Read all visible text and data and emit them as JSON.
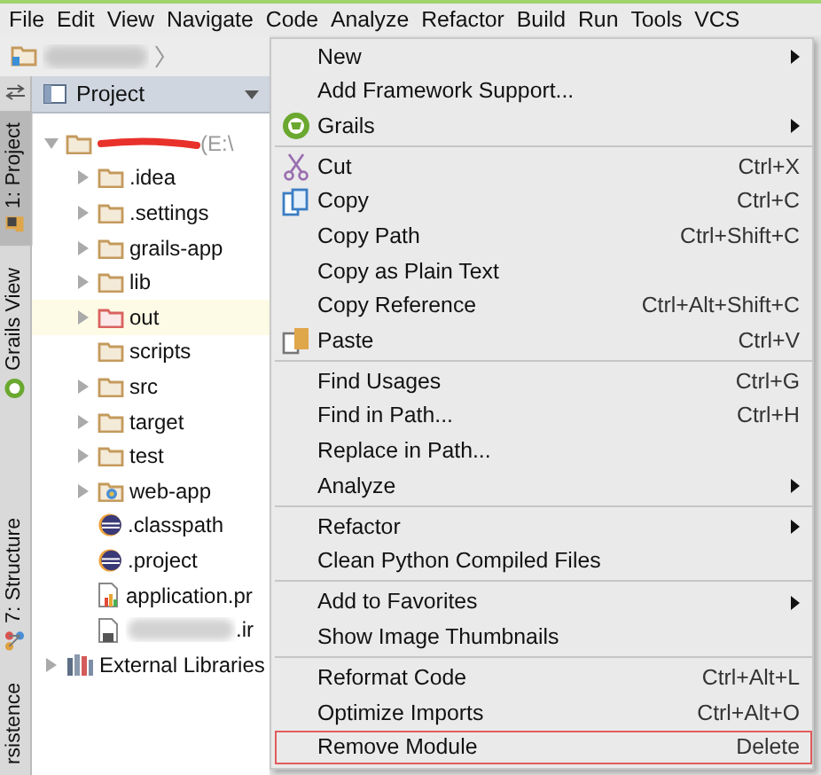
{
  "menu_bar": [
    "File",
    "Edit",
    "View",
    "Navigate",
    "Code",
    "Analyze",
    "Refactor",
    "Build",
    "Run",
    "Tools",
    "VCS"
  ],
  "breadcrumb": {
    "blurred": true
  },
  "tool_strip": [
    {
      "label": "1: Project",
      "selected": true,
      "kind": "project"
    },
    {
      "label": "Grails View",
      "selected": false,
      "kind": "grails"
    },
    {
      "label": "7: Structure",
      "selected": false,
      "kind": "structure"
    },
    {
      "label": "rsistence",
      "selected": false,
      "kind": "plain"
    }
  ],
  "project_panel": {
    "title": "Project",
    "tree": [
      {
        "label": "(E:\\",
        "kind": "folder",
        "expanded": true,
        "redacted": true,
        "children": [
          {
            "label": ".idea",
            "kind": "folder",
            "expanded": false
          },
          {
            "label": ".settings",
            "kind": "folder",
            "expanded": false
          },
          {
            "label": "grails-app",
            "kind": "folder",
            "expanded": false
          },
          {
            "label": "lib",
            "kind": "folder",
            "expanded": false
          },
          {
            "label": "out",
            "kind": "excluded",
            "expanded": false,
            "highlighted": true
          },
          {
            "label": "scripts",
            "kind": "folder"
          },
          {
            "label": "src",
            "kind": "folder",
            "expanded": false
          },
          {
            "label": "target",
            "kind": "folder",
            "expanded": false
          },
          {
            "label": "test",
            "kind": "folder",
            "expanded": false
          },
          {
            "label": "web-app",
            "kind": "web",
            "expanded": false
          },
          {
            "label": ".classpath",
            "kind": "eclipse"
          },
          {
            "label": ".project",
            "kind": "eclipse"
          },
          {
            "label": "application.pr",
            "kind": "properties"
          },
          {
            "label": ".ir",
            "kind": "file",
            "blurred": true
          }
        ]
      },
      {
        "label": "External Libraries",
        "kind": "library",
        "expanded": false
      }
    ]
  },
  "context_menu": [
    {
      "label": "New",
      "submenu": true
    },
    {
      "label": "Add Framework Support..."
    },
    {
      "label": "Grails",
      "kind": "grails",
      "submenu": true,
      "separator_after": true
    },
    {
      "label": "Cut",
      "kind": "cut",
      "shortcut": "Ctrl+X"
    },
    {
      "label": "Copy",
      "kind": "copy",
      "shortcut": "Ctrl+C"
    },
    {
      "label": "Copy Path",
      "shortcut": "Ctrl+Shift+C"
    },
    {
      "label": "Copy as Plain Text"
    },
    {
      "label": "Copy Reference",
      "shortcut": "Ctrl+Alt+Shift+C"
    },
    {
      "label": "Paste",
      "kind": "paste",
      "shortcut": "Ctrl+V",
      "separator_after": true
    },
    {
      "label": "Find Usages",
      "shortcut": "Ctrl+G"
    },
    {
      "label": "Find in Path...",
      "shortcut": "Ctrl+H"
    },
    {
      "label": "Replace in Path..."
    },
    {
      "label": "Analyze",
      "submenu": true,
      "separator_after": true
    },
    {
      "label": "Refactor",
      "submenu": true
    },
    {
      "label": "Clean Python Compiled Files",
      "separator_after": true
    },
    {
      "label": "Add to Favorites",
      "submenu": true
    },
    {
      "label": "Show Image Thumbnails",
      "separator_after": true
    },
    {
      "label": "Reformat Code",
      "shortcut": "Ctrl+Alt+L"
    },
    {
      "label": "Optimize Imports",
      "shortcut": "Ctrl+Alt+O"
    },
    {
      "label": "Remove Module",
      "shortcut": "Delete",
      "highlighted": true
    }
  ]
}
